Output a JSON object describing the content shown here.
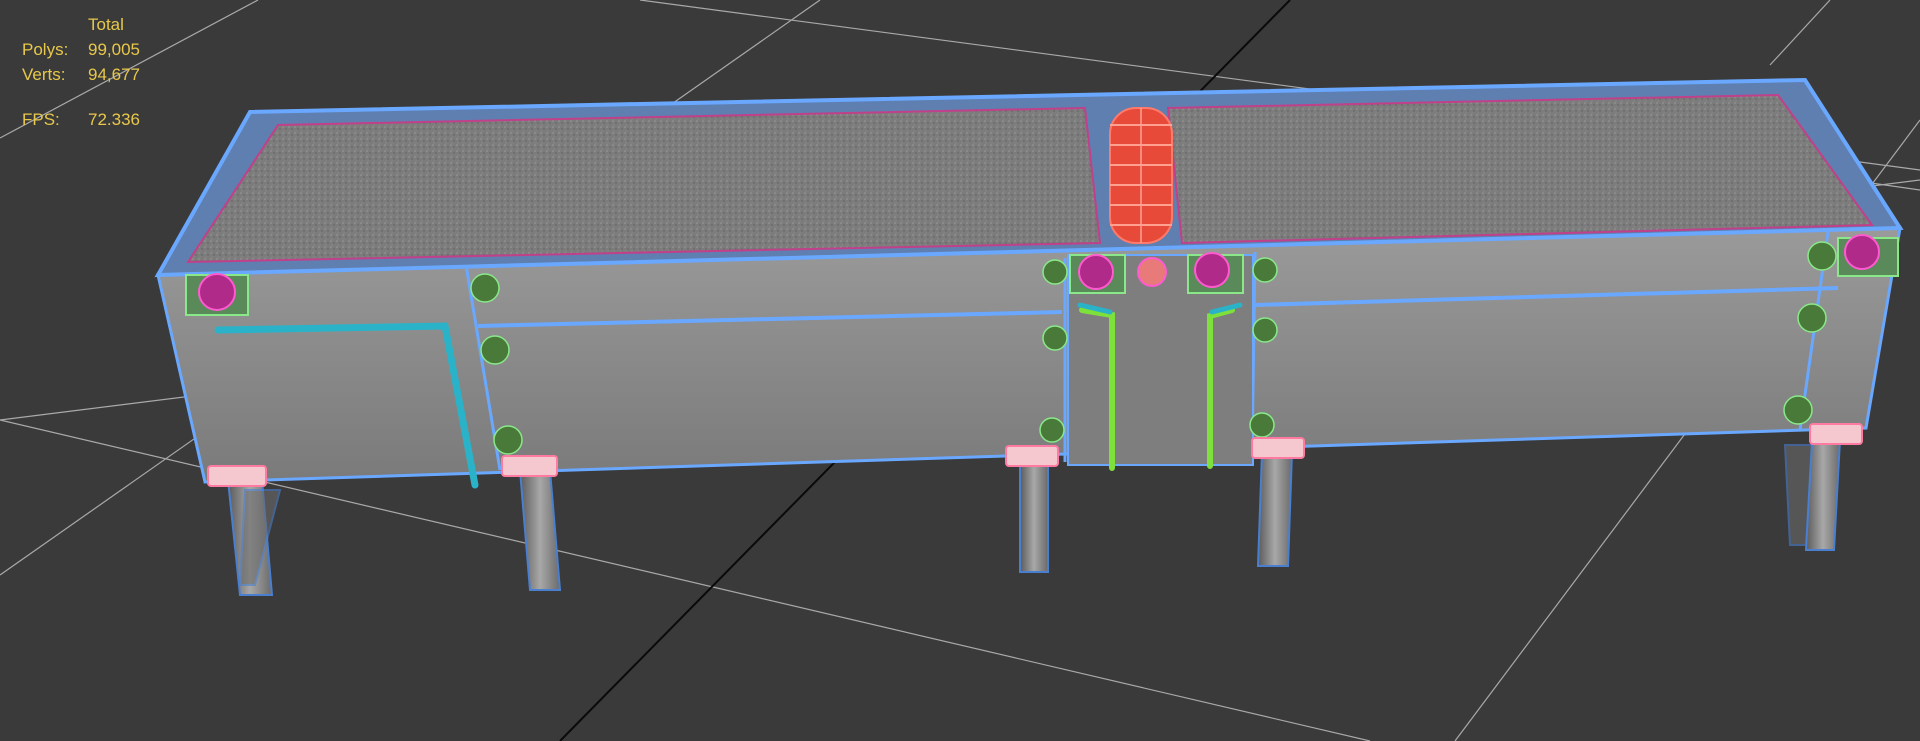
{
  "stats": {
    "header": "Total",
    "polys_label": "Polys:",
    "polys_value": "99,005",
    "verts_label": "Verts:",
    "verts_value": "94,677",
    "fps_label": "FPS:",
    "fps_value": "72.336"
  },
  "colors": {
    "background": "#3a3a3a",
    "grid": "#c8c8c8",
    "grid_center": "#0a0a0a",
    "stats_text": "#e8c84a",
    "frame_wire": "#6aa8ff",
    "belt": "#808080",
    "side_panel": "#8c8c8c",
    "roller": "#ff5a4a",
    "motor": "#cc3399",
    "cable_teal": "#2ab3c8",
    "cable_green": "#7ee03a",
    "foot_pad": "#f5c8d0"
  },
  "icons": [
    "motor-icon",
    "roller-icon"
  ]
}
